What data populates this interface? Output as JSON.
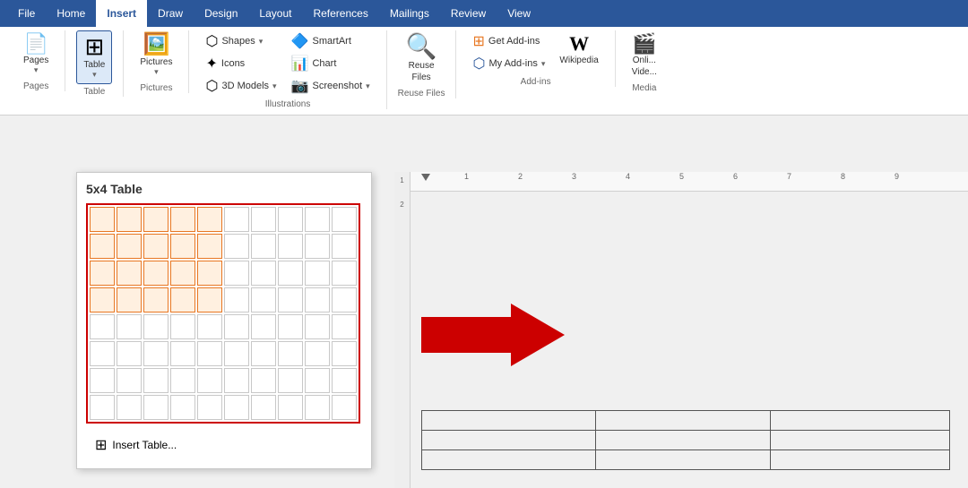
{
  "tabs": [
    {
      "label": "File",
      "active": false
    },
    {
      "label": "Home",
      "active": false
    },
    {
      "label": "Insert",
      "active": true
    },
    {
      "label": "Draw",
      "active": false
    },
    {
      "label": "Design",
      "active": false
    },
    {
      "label": "Layout",
      "active": false
    },
    {
      "label": "References",
      "active": false
    },
    {
      "label": "Mailings",
      "active": false
    },
    {
      "label": "Review",
      "active": false
    },
    {
      "label": "View",
      "active": false
    }
  ],
  "groups": {
    "pages": {
      "label": "Pages",
      "btn_label": "Pages"
    },
    "table": {
      "label": "Table",
      "btn_label": "Table"
    },
    "pictures": {
      "label": "Pictures",
      "btn_label": "Pictures"
    },
    "illustrations": {
      "shapes": "Shapes",
      "icons": "Icons",
      "models": "3D Models",
      "smartart": "SmartArt",
      "chart": "Chart",
      "screenshot": "Screenshot"
    },
    "reuse_files": {
      "label": "Reuse Files"
    },
    "addins": {
      "label": "Add-ins",
      "get_addins": "Get Add-ins",
      "my_addins": "My Add-ins",
      "wikipedia": "Wikipedia"
    },
    "media": {
      "label": "Media",
      "online_video": "Online Video"
    }
  },
  "dropdown": {
    "title": "5x4 Table",
    "grid_cols": 10,
    "grid_rows": 8,
    "highlighted_cols": 5,
    "highlighted_rows": 4,
    "insert_table_label": "Insert Table..."
  },
  "ruler": {
    "marks": [
      "1",
      "2",
      "3",
      "4",
      "5",
      "6",
      "7",
      "8",
      "9"
    ]
  },
  "colors": {
    "ribbon_bg": "#2b579a",
    "active_tab_text": "#2b579a",
    "highlight_cell": "#fff0e0",
    "highlight_border": "#e87722",
    "red_arrow": "#cc0000"
  }
}
